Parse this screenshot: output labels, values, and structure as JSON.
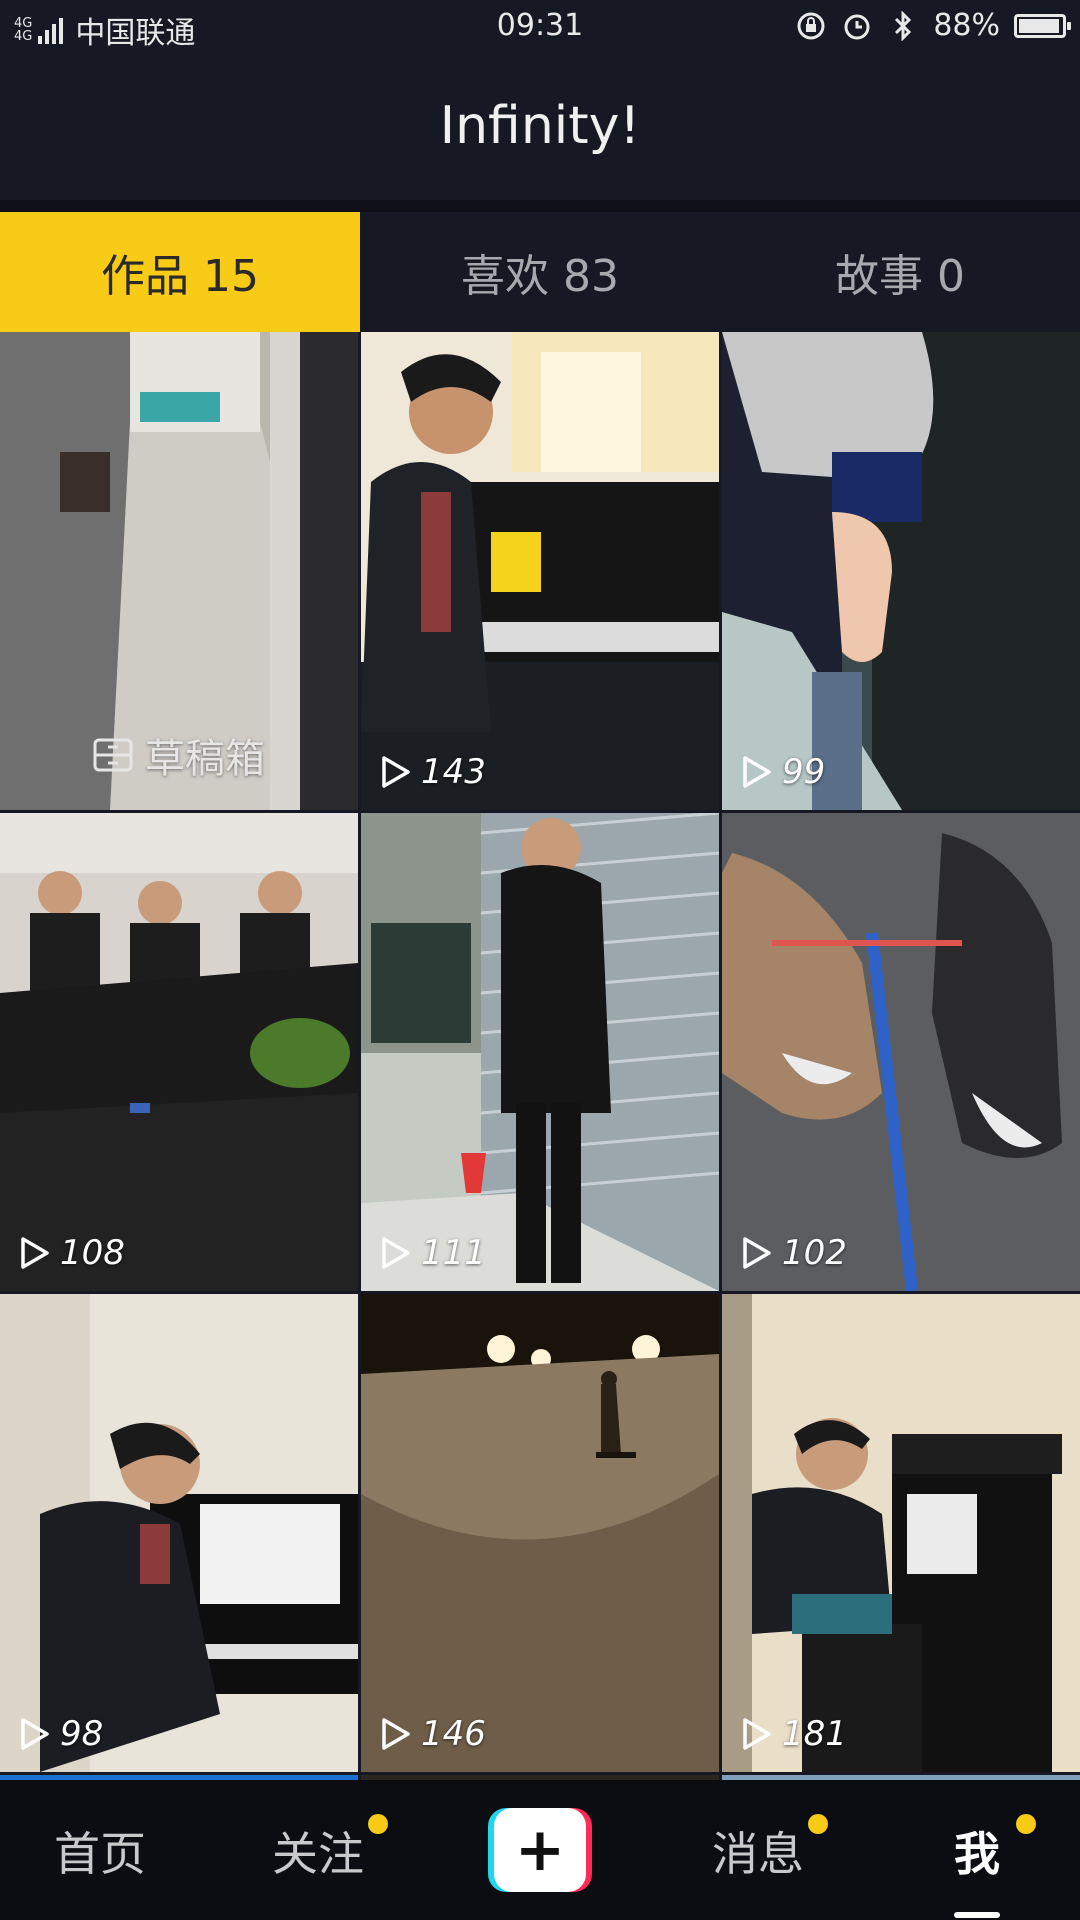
{
  "status_bar": {
    "network": [
      "4G",
      "4G"
    ],
    "carrier": "中国联通",
    "time": "09:31",
    "battery": "88%",
    "battery_level": 0.88
  },
  "header": {
    "title": "Infinity!"
  },
  "tabs": [
    {
      "label": "作品 15",
      "active": true
    },
    {
      "label": "喜欢 83",
      "active": false
    },
    {
      "label": "故事 0",
      "active": false
    }
  ],
  "grid": {
    "draft_label": "草稿箱",
    "videos": [
      {
        "views": "143"
      },
      {
        "views": "99"
      },
      {
        "views": "108"
      },
      {
        "views": "111"
      },
      {
        "views": "102"
      },
      {
        "views": "98"
      },
      {
        "views": "146"
      },
      {
        "views": "181"
      }
    ]
  },
  "bottom_nav": {
    "home": "首页",
    "follow": "关注",
    "messages": "消息",
    "me": "我",
    "badge_color": "#f8cb16",
    "accent_color": "#f8cb16"
  }
}
